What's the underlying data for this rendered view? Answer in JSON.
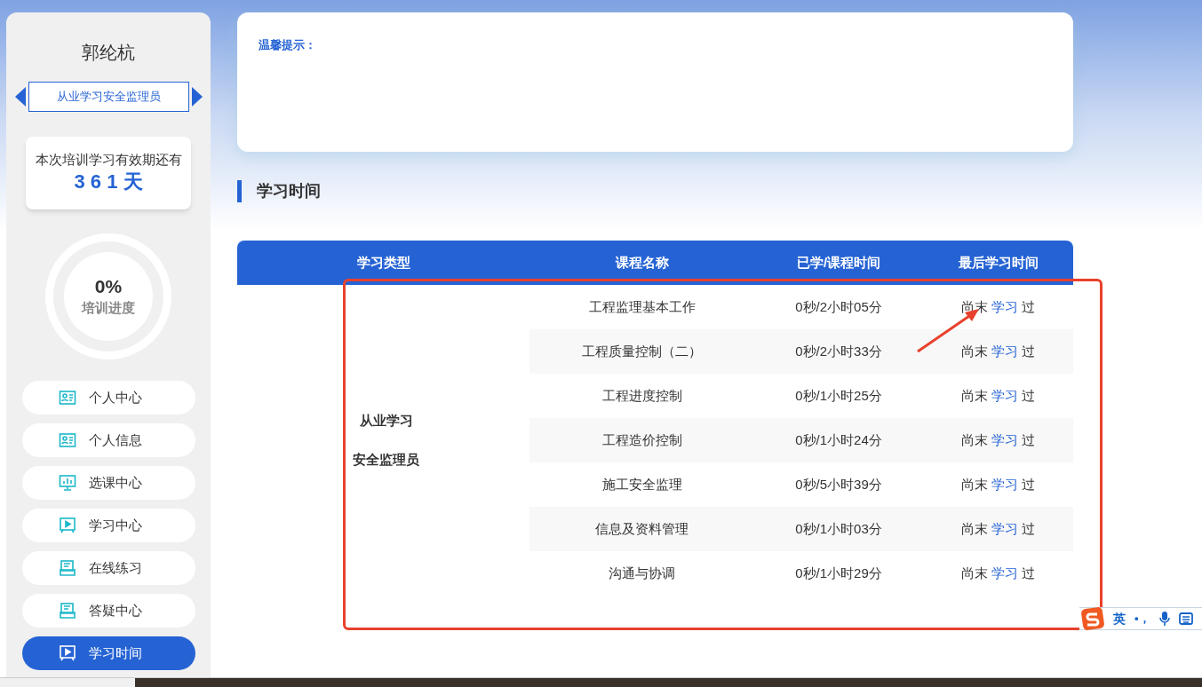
{
  "sidebar": {
    "user_name": "郭纶杭",
    "role_selector": {
      "value": "从业学习安全监理员"
    },
    "validity": {
      "label": "本次培训学习有效期还有",
      "days": "3 6 1 天"
    },
    "progress": {
      "percent": "0%",
      "label": "培训进度"
    },
    "nav": [
      {
        "label": "个人中心",
        "kind": "card",
        "selected": false
      },
      {
        "label": "个人信息",
        "kind": "card",
        "selected": false
      },
      {
        "label": "选课中心",
        "kind": "monitor",
        "selected": false
      },
      {
        "label": "学习中心",
        "kind": "play",
        "selected": false
      },
      {
        "label": "在线练习",
        "kind": "tray",
        "selected": false
      },
      {
        "label": "答疑中心",
        "kind": "tray",
        "selected": false
      },
      {
        "label": "学习时间",
        "kind": "play",
        "selected": true
      }
    ]
  },
  "tip_card": {
    "title": "温馨提示："
  },
  "section_title": "学习时间",
  "table": {
    "columns": [
      "学习类型",
      "课程名称",
      "已学/课程时间",
      "最后学习时间"
    ],
    "type_lines": [
      "从业学习",
      "安全监理员"
    ],
    "rows": [
      {
        "name": "工程监理基本工作",
        "time": "0秒/2小时05分",
        "last": [
          "尚末",
          "学习",
          "过"
        ]
      },
      {
        "name": "工程质量控制（二）",
        "time": "0秒/2小时33分",
        "last": [
          "尚末",
          "学习",
          "过"
        ]
      },
      {
        "name": "工程进度控制",
        "time": "0秒/1小时25分",
        "last": [
          "尚末",
          "学习",
          "过"
        ]
      },
      {
        "name": "工程造价控制",
        "time": "0秒/1小时24分",
        "last": [
          "尚末",
          "学习",
          "过"
        ]
      },
      {
        "name": "施工安全监理",
        "time": "0秒/5小时39分",
        "last": [
          "尚末",
          "学习",
          "过"
        ]
      },
      {
        "name": "信息及资料管理",
        "time": "0秒/1小时03分",
        "last": [
          "尚末",
          "学习",
          "过"
        ]
      },
      {
        "name": "沟通与协调",
        "time": "0秒/1小时29分",
        "last": [
          "尚末",
          "学习",
          "过"
        ]
      }
    ]
  },
  "ime_toolbar": {
    "mode": "英",
    "punctuation": "•，"
  }
}
